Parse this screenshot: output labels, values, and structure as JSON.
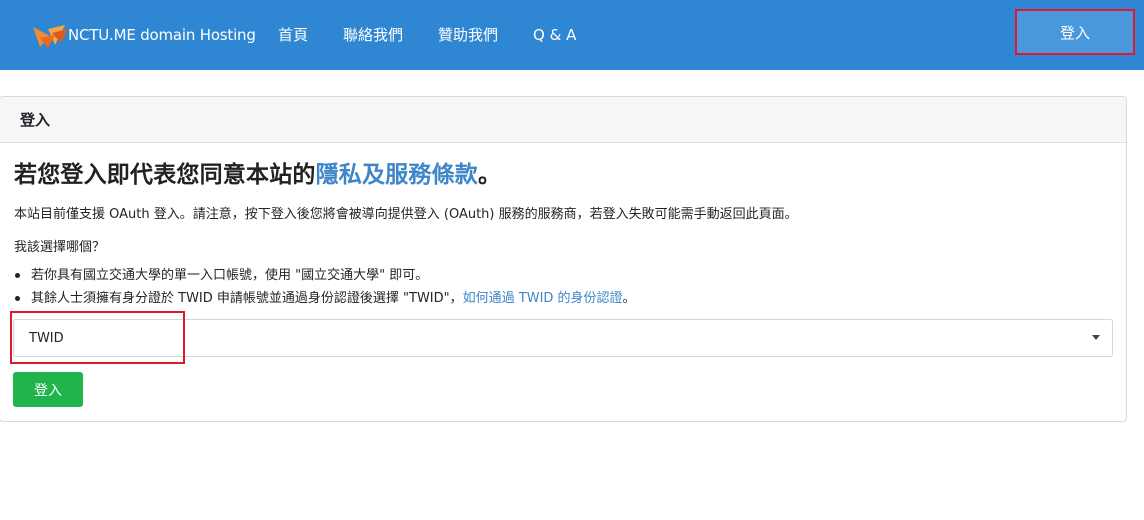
{
  "nav": {
    "brand": "NCTU.ME domain Hosting",
    "links": [
      "首頁",
      "聯絡我們",
      "贊助我們",
      "Q & A"
    ],
    "login": "登入"
  },
  "card": {
    "header": "登入",
    "title_prefix": "若您登入即代表您同意本站的",
    "title_link": "隱私及服務條款",
    "title_suffix": "。",
    "description": "本站目前僅支援 OAuth 登入。請注意，按下登入後您將會被導向提供登入 (OAuth) 服務的服務商，若登入失敗可能需手動返回此頁面。",
    "question": "我該選擇哪個？",
    "option1": "若你具有國立交通大學的單一入口帳號，使用 \"國立交通大學\" 即可。",
    "option2_text": "其餘人士須擁有身分證於 TWID 申請帳號並通過身份認證後選擇 \"TWID\"，",
    "option2_link": "如何通過 TWID 的身份認證",
    "option2_end": "。",
    "select_value": "TWID",
    "submit": "登入"
  },
  "colors": {
    "navbar": "#2f86d2",
    "link": "#3e86c8",
    "highlight": "#e0182d",
    "submit": "#21b34c"
  },
  "icons": {
    "brand": "fox-logo-icon",
    "select": "caret-down-icon"
  }
}
